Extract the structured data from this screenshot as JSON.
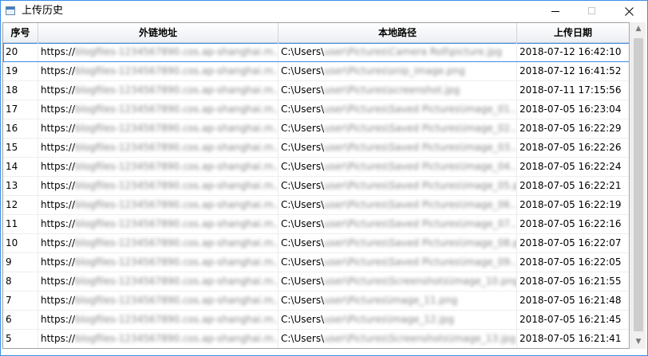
{
  "window": {
    "title": "上传历史",
    "icon": "app-window-icon"
  },
  "table": {
    "columns": [
      "序号",
      "外链地址",
      "本地路径",
      "上传日期"
    ],
    "rows": [
      {
        "index": "20",
        "url_prefix": "https://",
        "url_blur": "blogfiles-1234567890.cos.ap-shanghai.m...",
        "path_prefix": "C:\\Users\\",
        "path_blur": "user\\Pictures\\Camera Roll\\picture.jpg",
        "date": "2018-07-12 16:42:10"
      },
      {
        "index": "19",
        "url_prefix": "https://",
        "url_blur": "blogfiles-1234567890.cos.ap-shanghai.m...",
        "path_prefix": "C:\\Users\\",
        "path_blur": "user\\Pictures\\snip_image.png",
        "date": "2018-07-12 16:41:52"
      },
      {
        "index": "18",
        "url_prefix": "https://",
        "url_blur": "blogfiles-1234567890.cos.ap-shanghai.m...",
        "path_prefix": "C:\\Users\\",
        "path_blur": "user\\Pictures\\screenshot.jpg",
        "date": "2018-07-11 17:15:56"
      },
      {
        "index": "17",
        "url_prefix": "https://",
        "url_blur": "blogfiles-1234567890.cos.ap-shanghai.m...",
        "path_prefix": "C:\\Users\\",
        "path_blur": "user\\Pictures\\Saved Pictures\\image_01...",
        "date": "2018-07-05 16:23:04"
      },
      {
        "index": "16",
        "url_prefix": "https://",
        "url_blur": "blogfiles-1234567890.cos.ap-shanghai.m...",
        "path_prefix": "C:\\Users\\",
        "path_blur": "user\\Pictures\\Saved Pictures\\image_02...",
        "date": "2018-07-05 16:22:29"
      },
      {
        "index": "15",
        "url_prefix": "https://",
        "url_blur": "blogfiles-1234567890.cos.ap-shanghai.m...",
        "path_prefix": "C:\\Users\\",
        "path_blur": "user\\Pictures\\Saved Pictures\\image_03...",
        "date": "2018-07-05 16:22:26"
      },
      {
        "index": "14",
        "url_prefix": "https://",
        "url_blur": "blogfiles-1234567890.cos.ap-shanghai.m...",
        "path_prefix": "C:\\Users\\",
        "path_blur": "user\\Pictures\\Saved Pictures\\image_04...",
        "date": "2018-07-05 16:22:24"
      },
      {
        "index": "13",
        "url_prefix": "https://",
        "url_blur": "blogfiles-1234567890.cos.ap-shanghai.m...",
        "path_prefix": "C:\\Users\\",
        "path_blur": "user\\Pictures\\Saved Pictures\\image_05.png",
        "date": "2018-07-05 16:22:21"
      },
      {
        "index": "12",
        "url_prefix": "https://",
        "url_blur": "blogfiles-1234567890.cos.ap-shanghai.m...",
        "path_prefix": "C:\\Users\\",
        "path_blur": "user\\Pictures\\Saved Pictures\\image_06...",
        "date": "2018-07-05 16:22:19"
      },
      {
        "index": "11",
        "url_prefix": "https://",
        "url_blur": "blogfiles-1234567890.cos.ap-shanghai.m...",
        "path_prefix": "C:\\Users\\",
        "path_blur": "user\\Pictures\\Saved Pictures\\image_07...",
        "date": "2018-07-05 16:22:16"
      },
      {
        "index": "10",
        "url_prefix": "https://",
        "url_blur": "blogfiles-1234567890.cos.ap-shanghai.m...",
        "path_prefix": "C:\\Users\\",
        "path_blur": "user\\Pictures\\Saved Pictures\\image_08.png",
        "date": "2018-07-05 16:22:07"
      },
      {
        "index": "9",
        "url_prefix": "https://",
        "url_blur": "blogfiles-1234567890.cos.ap-shanghai.m...",
        "path_prefix": "C:\\Users\\",
        "path_blur": "user\\Pictures\\Saved Pictures\\image_09...",
        "date": "2018-07-05 16:22:05"
      },
      {
        "index": "8",
        "url_prefix": "https://",
        "url_blur": "blogfiles-1234567890.cos.ap-shanghai.m...",
        "path_prefix": "C:\\Users\\",
        "path_blur": "user\\Pictures\\Screenshots\\image_10.png",
        "date": "2018-07-05 16:21:55"
      },
      {
        "index": "7",
        "url_prefix": "https://",
        "url_blur": "blogfiles-1234567890.cos.ap-shanghai.m...",
        "path_prefix": "C:\\Users\\",
        "path_blur": "user\\Pictures\\image_11.png",
        "date": "2018-07-05 16:21:48"
      },
      {
        "index": "6",
        "url_prefix": "https://",
        "url_blur": "blogfiles-1234567890.cos.ap-shanghai.m...",
        "path_prefix": "C:\\Users\\",
        "path_blur": "user\\Pictures\\image_12.jpg",
        "date": "2018-07-05 16:21:45"
      },
      {
        "index": "5",
        "url_prefix": "https://",
        "url_blur": "blogfiles-1234567890.cos.ap-shanghai.m...",
        "path_prefix": "C:\\Users\\",
        "path_blur": "user\\Pictures\\Screenshots\\image_13.jpg",
        "date": "2018-07-05 16:21:41"
      }
    ],
    "selected_index": "20"
  },
  "colors": {
    "accent": "#3c8ee6",
    "header_border": "#c9cdd3"
  }
}
